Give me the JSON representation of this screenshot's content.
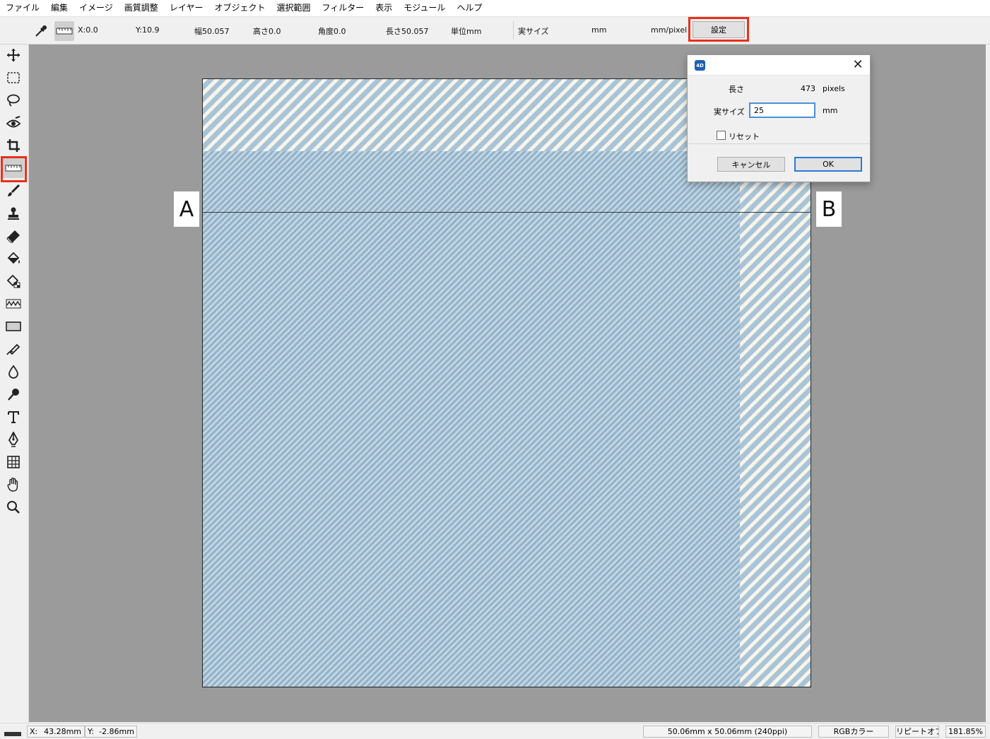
{
  "menubar": {
    "items": [
      "ファイル",
      "編集",
      "イメージ",
      "画質調整",
      "レイヤー",
      "オブジェクト",
      "選択範囲",
      "フィルター",
      "表示",
      "モジュール",
      "ヘルプ"
    ]
  },
  "optionbar": {
    "x": "X:0.0",
    "y": "Y:10.9",
    "width": "幅50.057",
    "height": "高さ0.0",
    "angle": "角度0.0",
    "length": "長さ50.057",
    "unit": "単位mm",
    "real_size_label": "実サイズ",
    "real_size_unit": "mm",
    "scale_unit": "mm/pixel",
    "settings_button": "設定"
  },
  "tools": [
    "move-icon",
    "rect-select-icon",
    "lasso-icon",
    "eye-icon",
    "crop-icon",
    "ruler-icon",
    "brush-icon",
    "stamp-icon",
    "eraser-icon",
    "bucket-icon",
    "gradient-fill-icon",
    "wave-icon",
    "rectangle-shape-icon",
    "pen-edit-icon",
    "drop-icon",
    "smudge-icon",
    "text-icon",
    "pen-tool-icon",
    "transform-icon",
    "hand-icon",
    "zoom-icon"
  ],
  "canvas": {
    "point_a": "A",
    "point_b": "B"
  },
  "dialog": {
    "app_icon_text": "4D",
    "length_label": "長さ",
    "length_value": "473",
    "length_unit": "pixels",
    "real_size_label": "実サイズ",
    "real_size_value": "25",
    "real_size_unit": "mm",
    "reset_label": "リセット",
    "cancel_button": "キャンセル",
    "ok_button": "OK"
  },
  "statusbar": {
    "x_label": "X:",
    "x_value": "43.28mm",
    "y_label": "Y:",
    "y_value": "-2.86mm",
    "image_size": "50.06mm x 50.06mm (240ppi)",
    "color_mode": "RGBカラー",
    "repeat": "リピートオフ",
    "zoom": "181.85%"
  },
  "colors": {
    "highlight_red": "#e8311a",
    "input_focus": "#4a90d9",
    "workspace_gray": "#9b9b9b"
  }
}
